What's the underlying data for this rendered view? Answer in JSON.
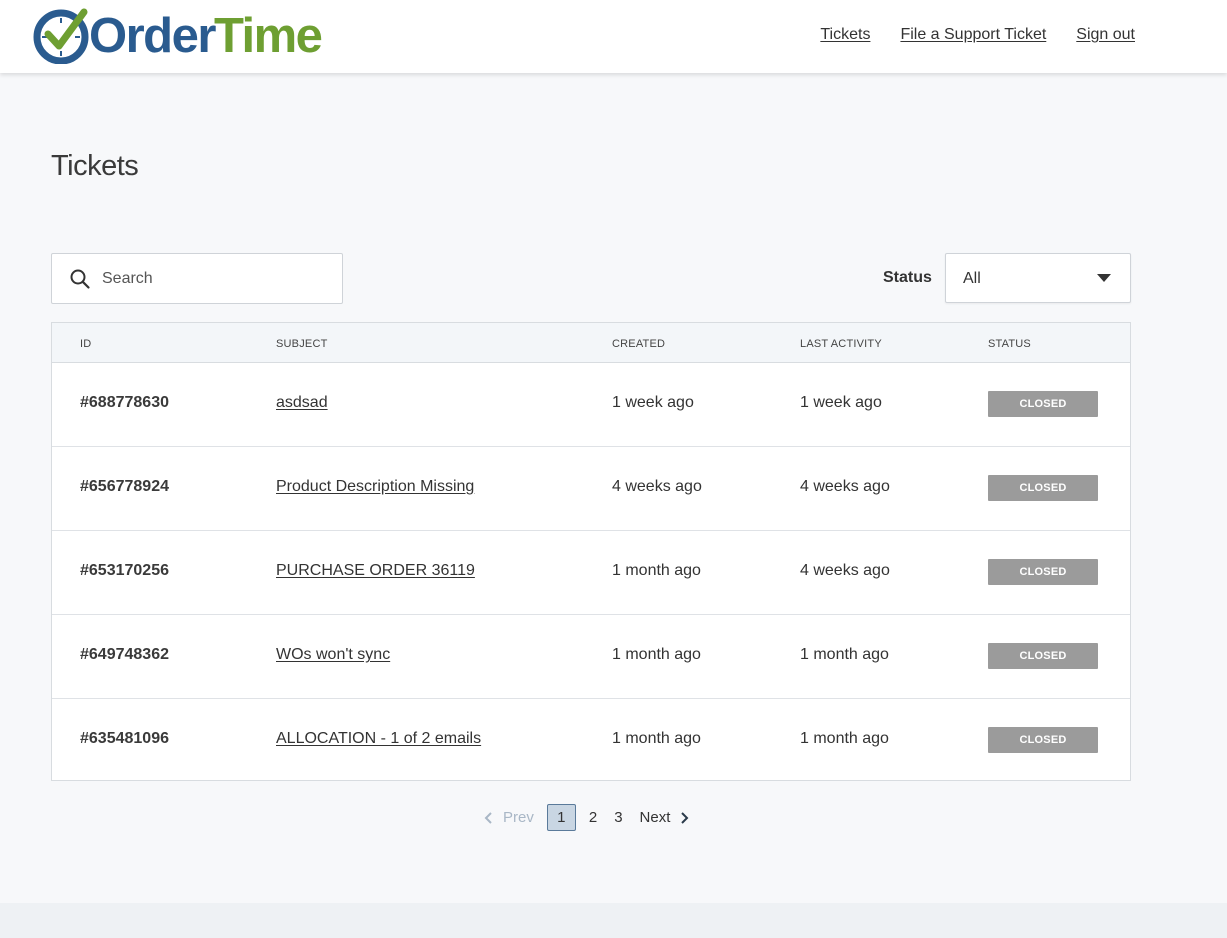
{
  "brand": {
    "logo_part1": "Order",
    "logo_part2": "Time",
    "colors": {
      "blue": "#2a5b8f",
      "green": "#6e9f32"
    }
  },
  "nav": {
    "tickets": "Tickets",
    "file_ticket": "File a Support Ticket",
    "sign_out": "Sign out"
  },
  "page": {
    "title": "Tickets"
  },
  "search": {
    "placeholder": "Search",
    "value": ""
  },
  "filter": {
    "label": "Status",
    "selected": "All"
  },
  "table": {
    "columns": [
      "ID",
      "SUBJECT",
      "CREATED",
      "LAST ACTIVITY",
      "STATUS"
    ],
    "rows": [
      {
        "id": "#688778630",
        "subject": "asdsad",
        "created": "1 week ago",
        "last_activity": "1 week ago",
        "status": "CLOSED"
      },
      {
        "id": "#656778924",
        "subject": "Product Description Missing",
        "created": "4 weeks ago",
        "last_activity": "4 weeks ago",
        "status": "CLOSED"
      },
      {
        "id": "#653170256",
        "subject": "PURCHASE ORDER 36119",
        "created": "1 month ago",
        "last_activity": "4 weeks ago",
        "status": "CLOSED"
      },
      {
        "id": "#649748362",
        "subject": "WOs won't sync",
        "created": "1 month ago",
        "last_activity": "1 month ago",
        "status": "CLOSED"
      },
      {
        "id": "#635481096",
        "subject": "ALLOCATION - 1 of 2 emails",
        "created": "1 month ago",
        "last_activity": "1 month ago",
        "status": "CLOSED"
      }
    ]
  },
  "pagination": {
    "prev": "Prev",
    "pages": [
      "1",
      "2",
      "3"
    ],
    "current": "1",
    "next": "Next"
  }
}
